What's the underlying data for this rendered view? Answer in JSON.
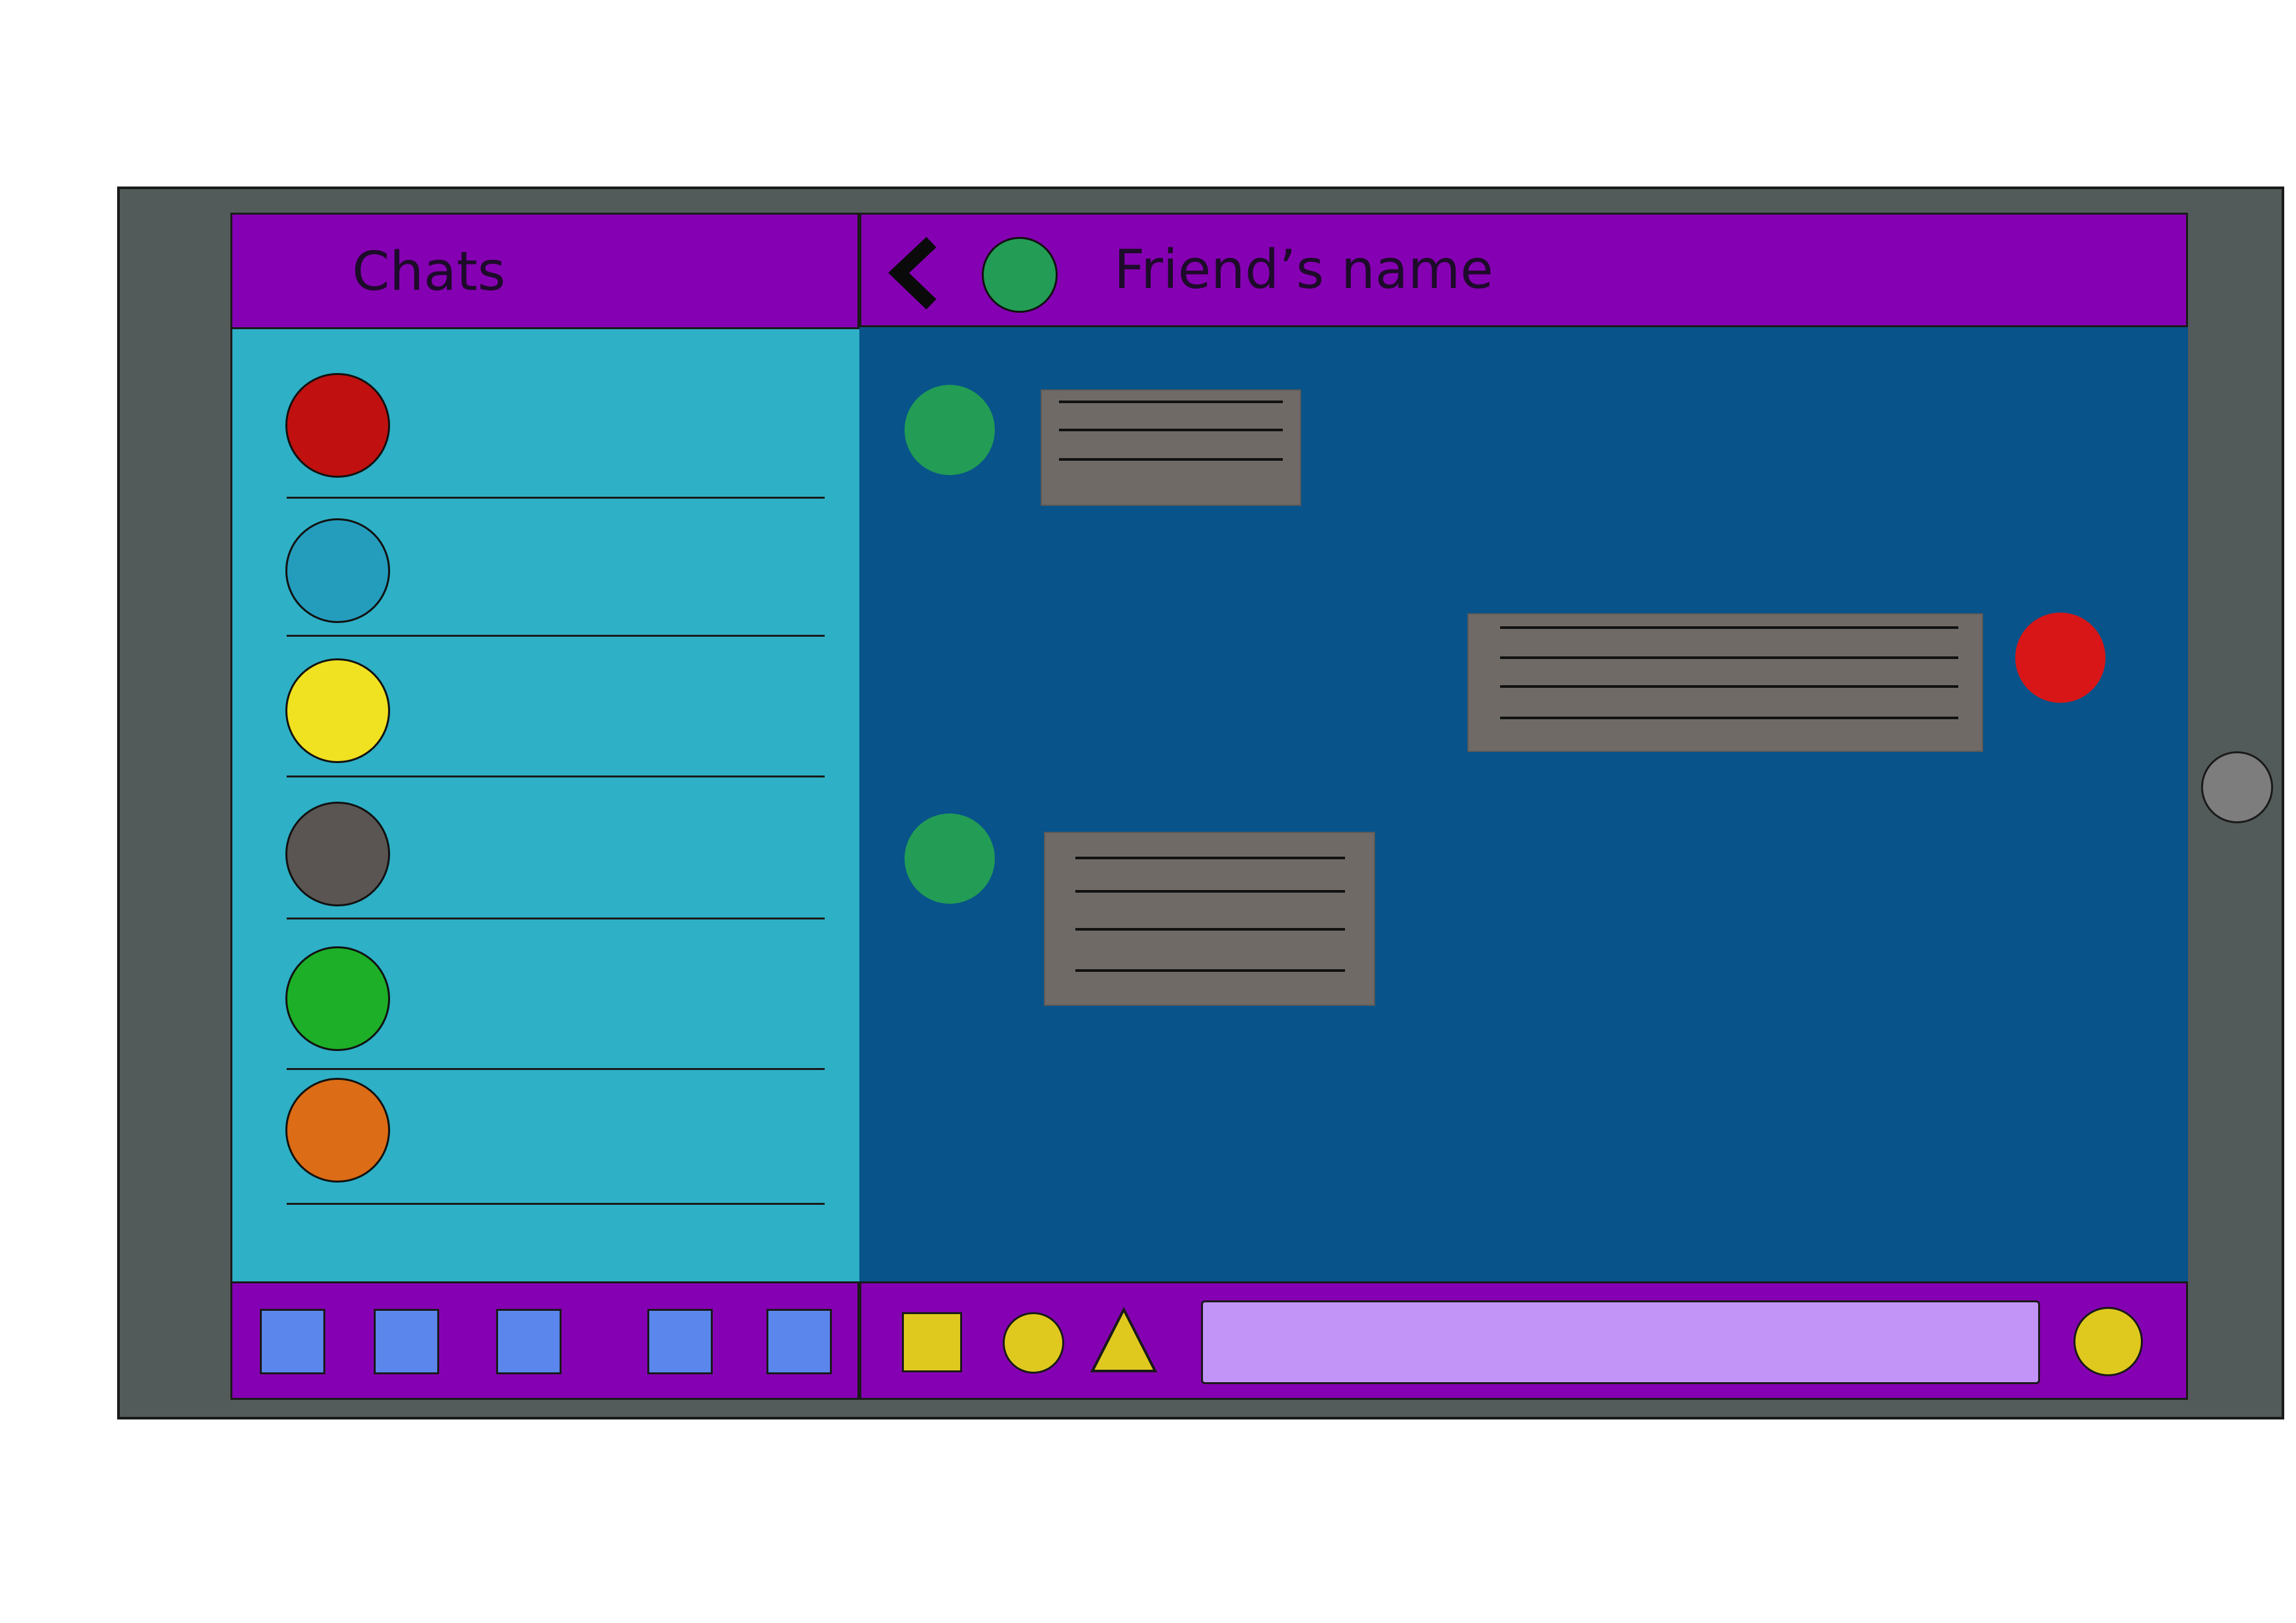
{
  "header": {
    "left_title": "Chats",
    "friend_name": "Friend’s name",
    "friend_avatar_color": "#239c55",
    "back_icon": "chevron-left-icon"
  },
  "chat_list": {
    "contacts": [
      {
        "avatar_color": "#c01010"
      },
      {
        "avatar_color": "#249dbd"
      },
      {
        "avatar_color": "#f0e121"
      },
      {
        "avatar_color": "#5a5552"
      },
      {
        "avatar_color": "#1daf27"
      },
      {
        "avatar_color": "#dc6c15"
      }
    ]
  },
  "messages": [
    {
      "sender": "friend",
      "avatar_color": "#239c55",
      "text_line_count": 3
    },
    {
      "sender": "me",
      "avatar_color": "#d81617",
      "text_line_count": 4
    },
    {
      "sender": "friend",
      "avatar_color": "#239c55",
      "text_line_count": 4
    }
  ],
  "left_footer": {
    "nav_icons": [
      "nav-square-icon",
      "nav-square-icon",
      "nav-square-icon",
      "nav-square-icon",
      "nav-square-icon"
    ],
    "nav_color": "#5b86ec"
  },
  "right_footer": {
    "attachment_icons": [
      "square-icon",
      "circle-icon",
      "triangle-icon"
    ],
    "accent_color": "#dfc91f",
    "input_value": "",
    "input_placeholder": "",
    "send_icon": "circle-icon"
  },
  "colors": {
    "header": "#8600b3",
    "chat_list_bg": "#2eb0c6",
    "chat_area_bg": "#08538a",
    "bubble": "#6f6a66",
    "input_bg": "#c394f7",
    "frame": "#525b5a"
  }
}
